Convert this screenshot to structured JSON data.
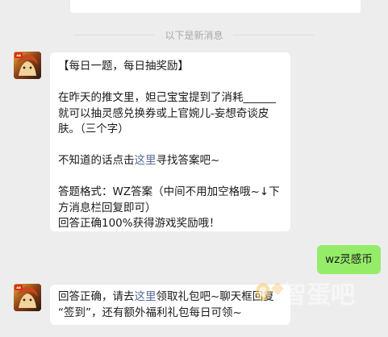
{
  "divider": {
    "text": "以下是新消息"
  },
  "messages": [
    {
      "sender": "bot",
      "avatar_icon": "game-hero-avatar-icon",
      "lines": [
        "【每日一题，每日抽奖励】",
        "",
        "在昨天的推文里，妲己宝宝提到了消耗______",
        "就可以抽灵感兑换券或上官婉儿-妄想奇谈皮",
        "肤。（三个字）",
        "",
        "不知道的话点击",
        "",
        "答题格式：WZ答案（中间不用加空格哦~↓下",
        "方消息栏回复即可）",
        "回答正确100%获得游戏奖励哦！"
      ],
      "hint_prefix": "不知道的话点击",
      "hint_link": "这里",
      "hint_suffix": "寻找答案吧~"
    },
    {
      "sender": "user",
      "text": "wz灵感币"
    },
    {
      "sender": "bot",
      "avatar_icon": "game-hero-avatar-icon",
      "line1_prefix": "回答正确，请去",
      "line1_link": "这里",
      "line1_suffix": "领取礼包吧~聊天框回复",
      "line2": "“签到”，还有额外福利礼包每日可领~"
    }
  ],
  "watermark": {
    "text": "智蛋吧",
    "icon": "egg-logo-icon"
  },
  "colors": {
    "background": "#ededed",
    "bubble_received": "#ffffff",
    "bubble_sent": "#95ec69",
    "link": "#576b95",
    "divider_text": "#a8a8a8"
  }
}
